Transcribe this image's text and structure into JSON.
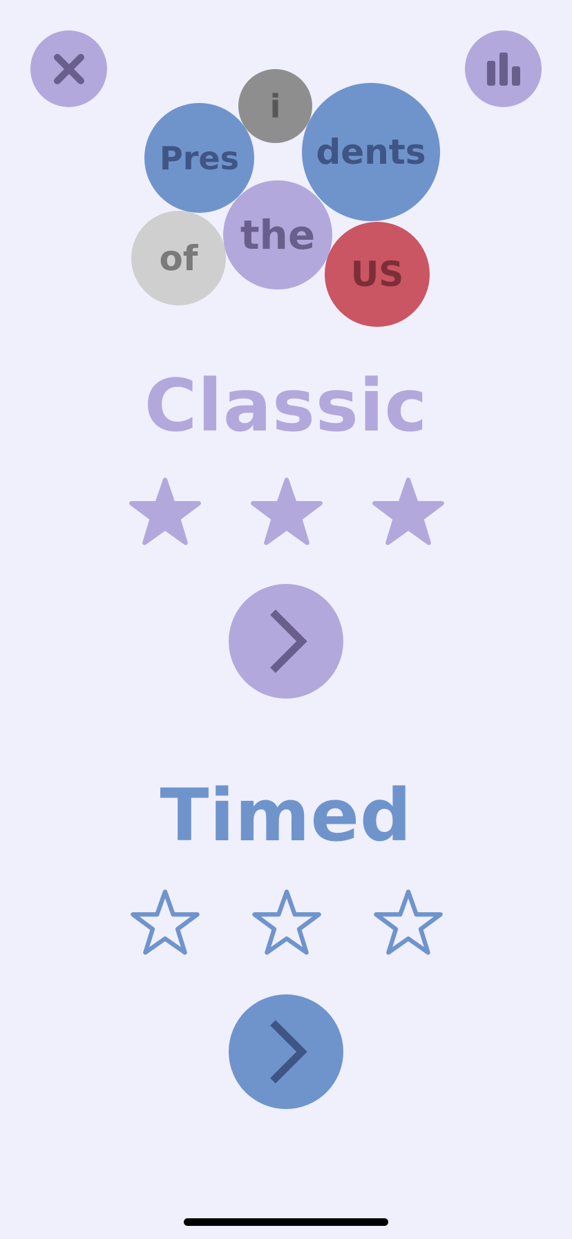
{
  "colors": {
    "background": "#f0f0fd",
    "lavender": "#b3a8dc",
    "lavender_dark": "#6a5f8c",
    "blue": "#6f94cc",
    "blue_dark": "#3e5585",
    "gray": "#8e8e8e",
    "gray_dark": "#575757",
    "light_gray": "#cfcfcf",
    "light_gray_text": "#7a7a7a",
    "red": "#c95662",
    "red_dark": "#7d2e38"
  },
  "top_bar": {
    "close_icon": "close-icon",
    "stats_icon": "bar-chart-icon"
  },
  "title_bubbles": [
    {
      "text": "i"
    },
    {
      "text": "Pres"
    },
    {
      "text": "dents"
    },
    {
      "text": "of"
    },
    {
      "text": "the"
    },
    {
      "text": "US"
    }
  ],
  "modes": {
    "classic": {
      "title": "Classic",
      "stars_earned": 3,
      "stars_total": 3,
      "play_icon": "chevron-right-icon"
    },
    "timed": {
      "title": "Timed",
      "stars_earned": 0,
      "stars_total": 3,
      "play_icon": "chevron-right-icon"
    }
  }
}
